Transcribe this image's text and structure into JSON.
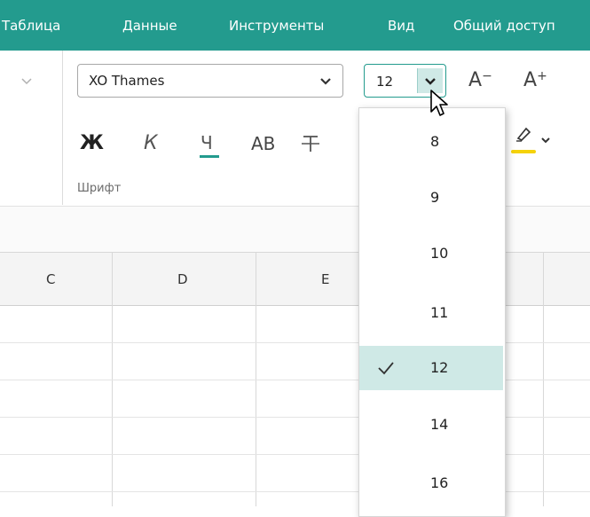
{
  "menubar": {
    "items": [
      "Таблица",
      "Данные",
      "Инструменты",
      "Вид",
      "Общий доступ"
    ],
    "background": "#239b8e"
  },
  "toolbar": {
    "font_name": "XO Thames",
    "font_size": "12",
    "decrease_size_label": "A",
    "increase_size_label": "A",
    "bold_label": "Ж",
    "italic_label": "К",
    "underline_label": "Ч",
    "caps_label": "АВ",
    "group_label": "Шрифт",
    "highlight_color": "#f5d20a",
    "accent": "#239b8e"
  },
  "icons": {
    "strikethrough": "strikethrough-icon",
    "highlighter": "highlighter-icon",
    "check": "check-icon",
    "chevron": "chevron-down-icon"
  },
  "columns": [
    "C",
    "D",
    "E"
  ],
  "size_dropdown": {
    "options": [
      "8",
      "9",
      "10",
      "11",
      "12",
      "14",
      "16"
    ],
    "selected": "12",
    "selected_background": "#cfe9e6"
  }
}
